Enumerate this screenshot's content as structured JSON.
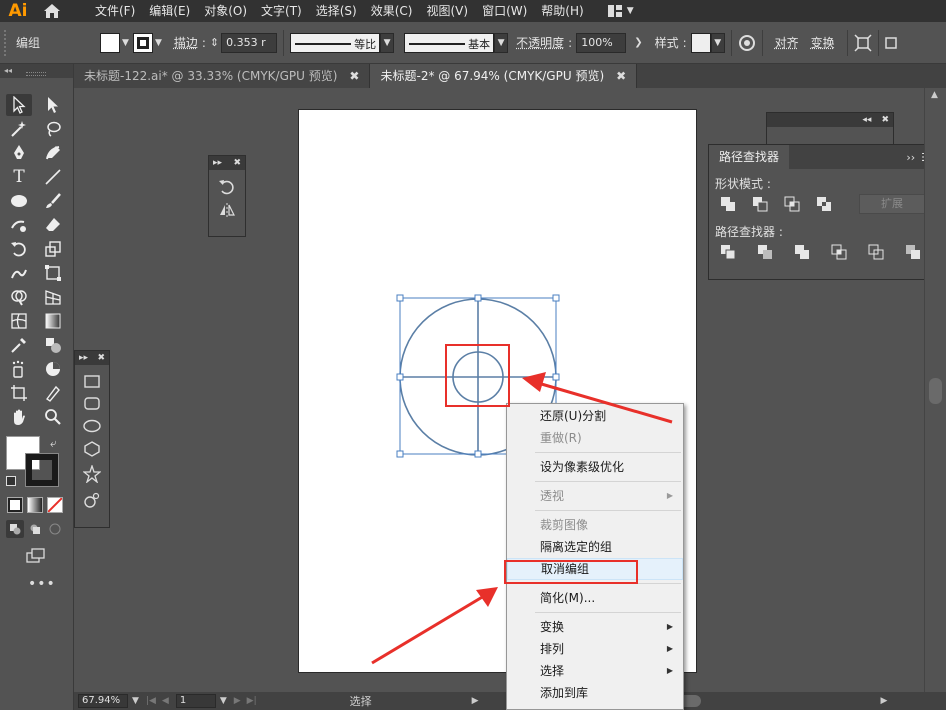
{
  "app": {
    "logo": "Ai"
  },
  "menu": [
    "文件(F)",
    "编辑(E)",
    "对象(O)",
    "文字(T)",
    "选择(S)",
    "效果(C)",
    "视图(V)",
    "窗口(W)",
    "帮助(H)"
  ],
  "control_bar": {
    "selection_label": "编组",
    "stroke_label": "描边",
    "stroke_width": "0.353 r",
    "stroke_profile": "等比",
    "brush": "基本",
    "opacity_label": "不透明度",
    "opacity_value": "100%",
    "style_label": "样式",
    "align_label": "对齐",
    "transform_label": "变换"
  },
  "tabs": [
    {
      "label": "未标题-122.ai* @ 33.33% (CMYK/GPU 预览)",
      "active": false
    },
    {
      "label": "未标题-2* @ 67.94% (CMYK/GPU 预览)",
      "active": true
    }
  ],
  "pathfinder": {
    "title": "路径查找器",
    "shape_modes_label": "形状模式",
    "pathfinders_label": "路径查找器",
    "expand_label": "扩展"
  },
  "context_menu": {
    "items": [
      {
        "label": "还原(U)分割",
        "disabled": false,
        "submenu": false
      },
      {
        "label": "重做(R)",
        "disabled": true,
        "submenu": false
      },
      {
        "label": "设为像素级优化",
        "disabled": false,
        "submenu": false
      },
      {
        "label": "透视",
        "disabled": true,
        "submenu": true
      },
      {
        "label": "裁剪图像",
        "disabled": true,
        "submenu": false
      },
      {
        "label": "隔离选定的组",
        "disabled": false,
        "submenu": false
      },
      {
        "label": "取消编组",
        "disabled": false,
        "submenu": false,
        "hover": true
      },
      {
        "label": "简化(M)...",
        "disabled": false,
        "submenu": false
      },
      {
        "label": "变换",
        "disabled": false,
        "submenu": true
      },
      {
        "label": "排列",
        "disabled": false,
        "submenu": true
      },
      {
        "label": "选择",
        "disabled": false,
        "submenu": true
      },
      {
        "label": "添加到库",
        "disabled": false,
        "submenu": false
      }
    ]
  },
  "status_bar": {
    "zoom": "67.94%",
    "page": "1",
    "tool": "选择"
  },
  "colors": {
    "accent_red": "#e8302a",
    "selection_blue": "#4a7fc1",
    "shape_stroke": "#5b7fa6"
  }
}
